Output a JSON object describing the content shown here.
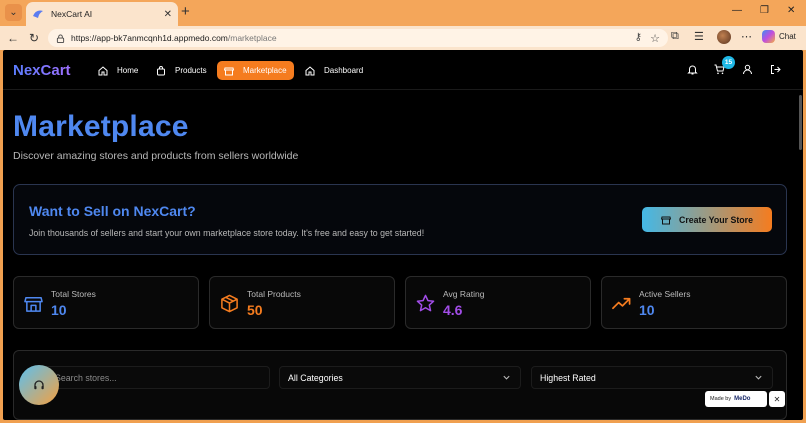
{
  "browser": {
    "tab_title": "NexCart AI",
    "url_host": "https://app-bk7anmcqnh1d.appmedo.com",
    "url_path": "/marketplace",
    "chat_label": "Chat"
  },
  "nav": {
    "logo": "NexCart",
    "links": [
      {
        "label": "Home",
        "icon": "home-icon"
      },
      {
        "label": "Products",
        "icon": "bag-icon"
      },
      {
        "label": "Marketplace",
        "icon": "store-icon",
        "active": true
      },
      {
        "label": "Dashboard",
        "icon": "home-icon"
      }
    ],
    "cart_count": "15"
  },
  "hero": {
    "title": "Marketplace",
    "subtitle": "Discover amazing stores and products from sellers worldwide"
  },
  "sell_banner": {
    "title": "Want to Sell on NexCart?",
    "description": "Join thousands of sellers and start your own marketplace store today. It's free and easy to get started!",
    "cta": "Create Your Store"
  },
  "stats": [
    {
      "label": "Total Stores",
      "value": "10",
      "icon": "store-icon",
      "color": "#4f88f0"
    },
    {
      "label": "Total Products",
      "value": "50",
      "icon": "package-icon",
      "color": "#f57c1f"
    },
    {
      "label": "Avg Rating",
      "value": "4.6",
      "icon": "star-icon",
      "color": "#a24de8"
    },
    {
      "label": "Active Sellers",
      "value": "10",
      "icon": "trending-up-icon",
      "color": "#f57c1f"
    }
  ],
  "filters": {
    "search_placeholder": "Search stores...",
    "category": "All Categories",
    "sort": "Highest Rated"
  },
  "badge": {
    "made_by": "Made by",
    "brand": "MeDo"
  },
  "colors": {
    "accent_blue": "#4f88f0",
    "accent_orange": "#f57c1f",
    "accent_purple": "#a24de8",
    "badge_cyan": "#1fb8e6"
  }
}
